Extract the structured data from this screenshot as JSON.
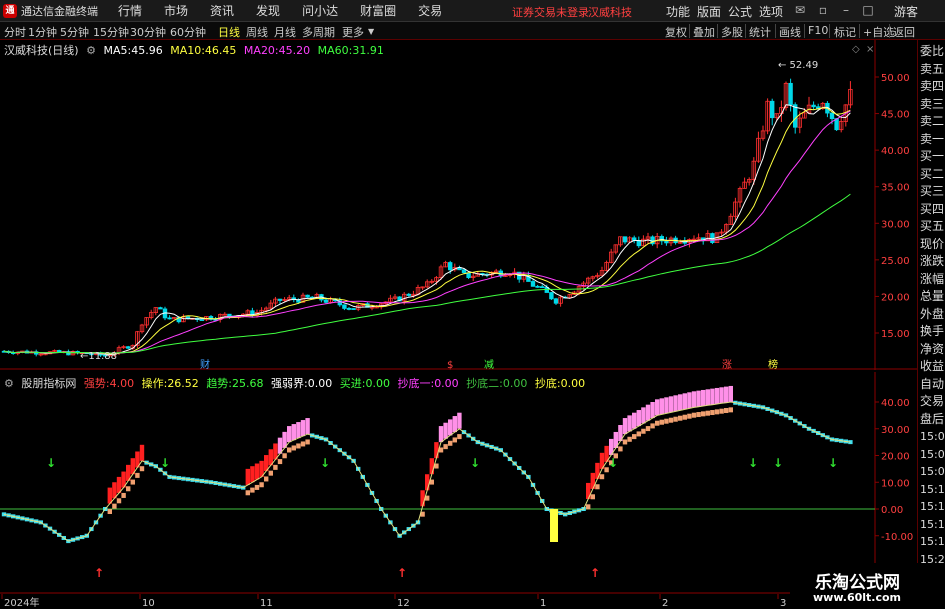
{
  "app": {
    "name": "通达信金融终端",
    "menus": [
      "行情",
      "市场",
      "资讯",
      "发现",
      "问小达",
      "财富圈",
      "交易"
    ],
    "notice": "证券交易未登录",
    "stock_tag": "汉威科技",
    "right_menus": [
      "功能",
      "版面",
      "公式",
      "选项"
    ],
    "user": "游客"
  },
  "toolbar": {
    "periods": [
      "分时",
      "1分钟",
      "5分钟",
      "15分钟",
      "30分钟",
      "60分钟",
      "日线",
      "周线",
      "月线",
      "多周期",
      "更多"
    ],
    "active_period": "日线",
    "right_tools": [
      "复权",
      "叠加",
      "多股",
      "统计",
      "画线",
      "F10",
      "标记",
      "+自选",
      "返回"
    ]
  },
  "main_chart": {
    "title": "汉威科技(日线)",
    "ma": [
      {
        "label": "MA5:",
        "value": "45.96",
        "color": "#ffffff"
      },
      {
        "label": "MA10:",
        "value": "46.45",
        "color": "#ffff40"
      },
      {
        "label": "MA20:",
        "value": "45.20",
        "color": "#ff40ff"
      },
      {
        "label": "MA60:",
        "value": "31.91",
        "color": "#40ff40"
      }
    ],
    "high_label": "52.49",
    "low_label": "11.88",
    "y_ticks": [
      "50.00",
      "45.00",
      "40.00",
      "35.00",
      "30.00",
      "25.00",
      "20.00",
      "15.00"
    ],
    "event_marks": [
      "财",
      "$",
      "减",
      "涨",
      "榜"
    ]
  },
  "indicator": {
    "name": "股朋指标网",
    "items": [
      {
        "label": "强势:",
        "value": "4.00",
        "color": "#ff4040"
      },
      {
        "label": "操作:",
        "value": "26.52",
        "color": "#ffff40"
      },
      {
        "label": "趋势:",
        "value": "25.68",
        "color": "#40ff40"
      },
      {
        "label": "强弱界:",
        "value": "0.00",
        "color": "#ffffff"
      },
      {
        "label": "买进:",
        "value": "0.00",
        "color": "#40ff40"
      },
      {
        "label": "抄底一:",
        "value": "0.00",
        "color": "#ff40ff"
      },
      {
        "label": "抄底二:",
        "value": "0.00",
        "color": "#40c040"
      },
      {
        "label": "抄底:",
        "value": "0.00",
        "color": "#ffff40"
      }
    ],
    "y_ticks": [
      "40.00",
      "30.00",
      "20.00",
      "10.00",
      "0.00",
      "-10.00"
    ]
  },
  "time_axis": [
    "2024年",
    "10",
    "11",
    "12",
    "1",
    "2",
    "3"
  ],
  "side_panel": [
    "委比",
    "卖五",
    "卖四",
    "卖三",
    "卖二",
    "卖一",
    "买一",
    "买二",
    "买三",
    "买四",
    "买五",
    "现价",
    "涨跌",
    "涨幅",
    "总量",
    "外盘",
    "换手",
    "净资",
    "收益",
    "自动",
    "交易",
    "盘后",
    "15:00",
    "15:08",
    "15:09",
    "15:11",
    "15:14",
    "15:15",
    "15:19",
    "15:21",
    "15:25",
    "15:29"
  ],
  "watermark": {
    "line1": "乐淘公式网",
    "line2": "www.60lt.com"
  }
}
